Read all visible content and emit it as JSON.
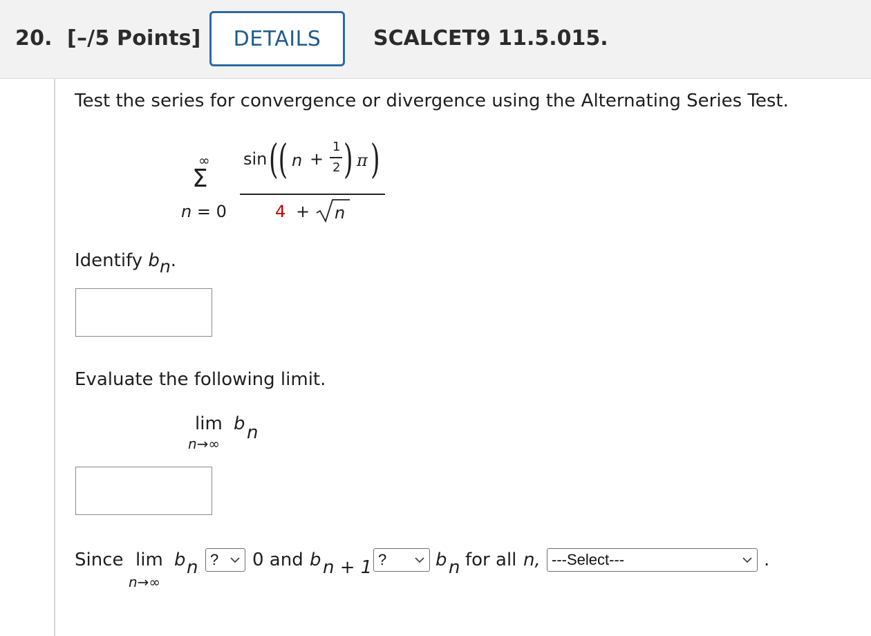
{
  "header": {
    "question_number": "20.",
    "points": "[–/5 Points]",
    "details_button": "DETAILS",
    "question_code": "SCALCET9 11.5.015."
  },
  "problem": {
    "instruction": "Test the series for convergence or divergence using the Alternating Series Test.",
    "series": {
      "upper_limit": "∞",
      "sigma": "Σ",
      "lower_limit": "n = 0",
      "numerator_sin": "sin",
      "numerator_n": "n",
      "numerator_plus": "+",
      "frac_top": "1",
      "frac_bottom": "2",
      "pi": "π",
      "denominator_four": "4",
      "denominator_plus": "+",
      "denominator_n": "n"
    }
  },
  "part1": {
    "prompt": "Identify ",
    "var_b": "b",
    "var_sub": "n",
    "period": "."
  },
  "part2": {
    "prompt": "Evaluate the following limit.",
    "lim": "lim",
    "var_b": "b",
    "var_sub": "n",
    "lim_sub": "n→∞"
  },
  "part3": {
    "since": "Since",
    "lim": "lim",
    "var_b": "b",
    "var_sub": "n",
    "lim_sub": "n→∞",
    "select1_value": "?",
    "zero_and": "0 and",
    "b2": "b",
    "sub2": "n + 1",
    "select2_value": "?",
    "b3": "b",
    "sub3": "n",
    "for_all": "for all",
    "for_all_n": "n,",
    "select3_value": "---Select---",
    "end_period": "."
  }
}
